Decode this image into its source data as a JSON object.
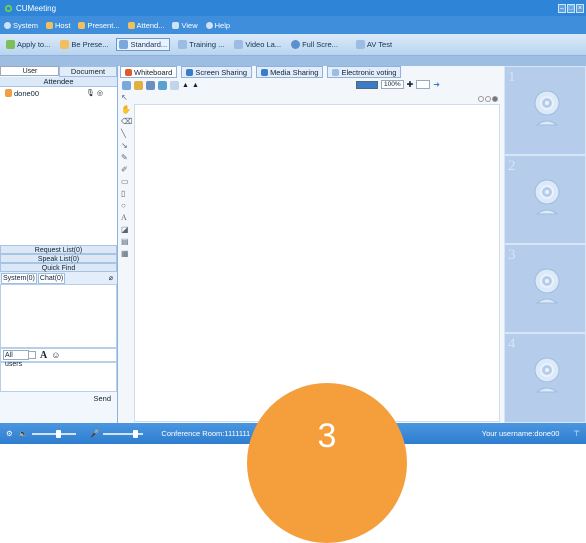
{
  "window": {
    "title": "CUMeeting"
  },
  "menu": [
    {
      "label": "System",
      "icon": "gear-icon"
    },
    {
      "label": "Host",
      "icon": "user-icon"
    },
    {
      "label": "Present...",
      "icon": "user-icon"
    },
    {
      "label": "Attend...",
      "icon": "user-icon"
    },
    {
      "label": "View",
      "icon": "window-icon"
    },
    {
      "label": "Help",
      "icon": "help-icon"
    }
  ],
  "toolbar": [
    {
      "label": "Apply to...",
      "icon": "apply-icon"
    },
    {
      "label": "Be Prese...",
      "icon": "user-icon"
    },
    {
      "label": "Standard...",
      "icon": "window-icon",
      "active": true
    },
    {
      "label": "Training ...",
      "icon": "window-icon"
    },
    {
      "label": "Video La...",
      "icon": "window-icon"
    },
    {
      "label": "Full Scre...",
      "icon": "fullscreen-icon"
    },
    {
      "label": "AV Test",
      "icon": "test-icon"
    }
  ],
  "left": {
    "tabs": [
      "User",
      "Document"
    ],
    "attendee_header": "Attendee",
    "attendees": [
      {
        "name": "done00"
      }
    ],
    "buttons": [
      "Request List(0)",
      "Speak List(0)",
      "Quick Find"
    ],
    "chat_tabs": [
      "System(0)",
      "Chat(0)"
    ],
    "recipient": "All users",
    "send_label": "Send"
  },
  "center": {
    "tabs": [
      "Whiteboard",
      "Screen Sharing",
      "Media Sharing",
      "Electronic voting"
    ],
    "zoom": "100%"
  },
  "video_slots": [
    "1",
    "2",
    "3",
    "4"
  ],
  "status": {
    "conference": "Conference Room:1111111",
    "username": "Your username:done00"
  },
  "overlay": {
    "step": "3"
  },
  "colors": {
    "titlebar": "#2e84d6",
    "accent": "#f59e3c",
    "panel": "#9dbde2"
  }
}
